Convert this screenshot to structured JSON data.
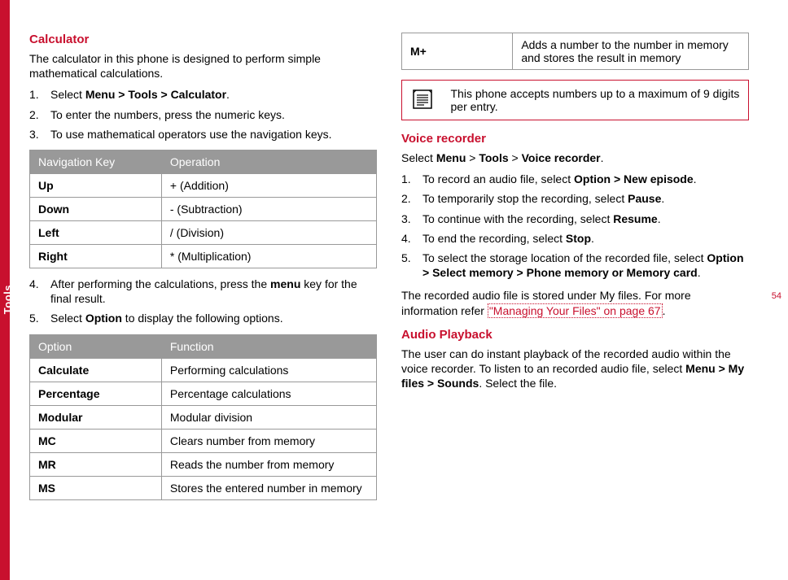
{
  "page_number": "54",
  "side_tab": "Tools",
  "left": {
    "h_calc": "Calculator",
    "calc_intro": "The calculator in this phone is designed to perform simple mathematical calculations.",
    "step1_a": "Select ",
    "step1_b": "Menu > Tools > Calculator",
    "step1_c": ".",
    "step2": "To enter the numbers, press the numeric keys.",
    "step3": "To use mathematical operators use the navigation keys.",
    "nav_th1": "Navigation Key",
    "nav_th2": "Operation",
    "nav": [
      {
        "k": "Up",
        "v": "+ (Addition)"
      },
      {
        "k": "Down",
        "v": "- (Subtraction)"
      },
      {
        "k": "Left",
        "v": "/ (Division)"
      },
      {
        "k": "Right",
        "v": "* (Multiplication)"
      }
    ],
    "step4_a": "After performing the calculations, press the ",
    "step4_b": "menu",
    "step4_c": " key for the final result.",
    "step5_a": "Select ",
    "step5_b": "Option",
    "step5_c": " to display the following options.",
    "opt_th1": "Option",
    "opt_th2": "Function",
    "opt": [
      {
        "k": "Calculate",
        "v": "Performing calculations"
      },
      {
        "k": "Percentage",
        "v": "Percentage calculations"
      },
      {
        "k": "Modular",
        "v": "Modular division"
      },
      {
        "k": "MC",
        "v": "Clears number from memory"
      },
      {
        "k": "MR",
        "v": "Reads the number from memory"
      },
      {
        "k": "MS",
        "v": "Stores the entered number in memory"
      }
    ]
  },
  "right": {
    "mplus_k": "M+",
    "mplus_v": "Adds a number to the number in memory and stores the result in memory",
    "note": "This phone accepts numbers up to a maximum of 9 digits per entry.",
    "h_voice": "Voice recorder",
    "vr_sel_a": "Select ",
    "vr_sel_b": "Menu",
    "vr_sel_c": " > ",
    "vr_sel_d": "Tools",
    "vr_sel_e": " > ",
    "vr_sel_f": "Voice recorder",
    "vr_sel_g": ".",
    "vr1_a": "To record an audio file, select ",
    "vr1_b": "Option > New episode",
    "vr1_c": ".",
    "vr2_a": "To temporarily stop the recording, select ",
    "vr2_b": "Pause",
    "vr2_c": ".",
    "vr3_a": "To continue with the recording, select ",
    "vr3_b": "Resume",
    "vr3_c": ".",
    "vr4_a": "To end the recording, select ",
    "vr4_b": "Stop",
    "vr4_c": ".",
    "vr5_a": "To select the storage location of the recorded file, select ",
    "vr5_b": "Option > Select memory > Phone memory or Memory card",
    "vr5_c": ".",
    "vr_tail_a": "The recorded audio file is stored under My files. For more information refer ",
    "vr_tail_link": "\"Managing Your Files\" on page 67",
    "vr_tail_b": ".",
    "h_audio": "Audio Playback",
    "ap_a": "The user can do instant playback of the recorded audio within the voice recorder. To listen to an recorded audio file, select ",
    "ap_b": "Menu > My files > Sounds",
    "ap_c": ". Select the file."
  }
}
